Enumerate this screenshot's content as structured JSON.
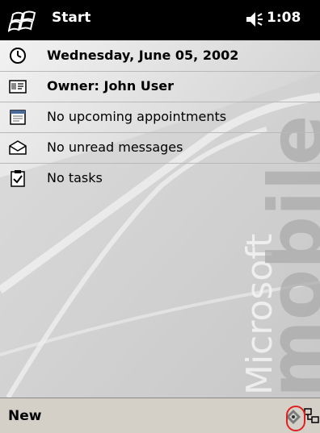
{
  "titlebar": {
    "start_label": "Start",
    "time": "1:08",
    "start_icon": "windows-flag-icon",
    "volume_icon": "speaker-icon"
  },
  "today": {
    "items": [
      {
        "icon": "clock-icon",
        "text": "Wednesday, June 05, 2002",
        "bold": true
      },
      {
        "icon": "owner-card-icon",
        "text": "Owner: John User",
        "bold": true
      },
      {
        "icon": "calendar-icon",
        "text": "No upcoming appointments",
        "bold": false
      },
      {
        "icon": "envelope-icon",
        "text": "No unread messages",
        "bold": false
      },
      {
        "icon": "tasks-checkbox-icon",
        "text": "No tasks",
        "bold": false
      }
    ],
    "watermark_brand": "Microsoft",
    "watermark_word": "mobile"
  },
  "menubar": {
    "new_label": "New",
    "input_icon": "input-panel-icon",
    "connectivity_icon": "connectivity-icon"
  },
  "colors": {
    "titlebar_bg": "#000000",
    "menubar_bg": "#d4d0c8",
    "highlight": "#e02020"
  }
}
